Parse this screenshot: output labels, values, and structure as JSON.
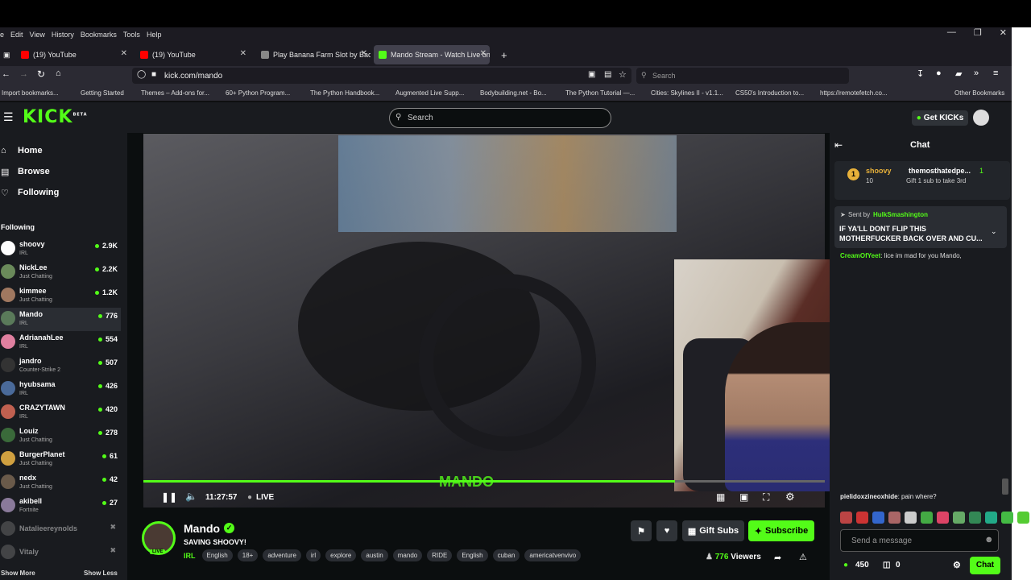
{
  "browser": {
    "menu": [
      "e",
      "Edit",
      "View",
      "History",
      "Bookmarks",
      "Tools",
      "Help"
    ],
    "tabs": [
      {
        "label": "(19) YouTube",
        "active": false
      },
      {
        "label": "(19) YouTube",
        "active": false
      },
      {
        "label": "Play Banana Farm Slot by Backs",
        "active": false
      },
      {
        "label": "Mando Stream - Watch Live on",
        "active": true
      }
    ],
    "url": "kick.com/mando",
    "search_placeholder": "Search",
    "bookmarks": [
      "Import bookmarks...",
      "Getting Started",
      "Themes – Add-ons for...",
      "60+ Python Program...",
      "The Python Handbook...",
      "Augmented Live Supp...",
      "Bodybuilding.net - Bo...",
      "The Python Tutorial —...",
      "Cities: Skylines II - v1.1...",
      "CS50's Introduction to...",
      "https://remotefetch.co...",
      "Other Bookmarks"
    ]
  },
  "header": {
    "logo": "KICK",
    "beta": "BETA",
    "search_placeholder": "Search",
    "get_kicks": "Get KICKs"
  },
  "sidebar": {
    "nav": [
      {
        "label": "Home"
      },
      {
        "label": "Browse"
      },
      {
        "label": "Following"
      }
    ],
    "section": "Following",
    "channels": [
      {
        "name": "shoovy",
        "category": "IRL",
        "viewers": "2.9K"
      },
      {
        "name": "NickLee",
        "category": "Just Chatting",
        "viewers": "2.2K"
      },
      {
        "name": "kimmee",
        "category": "Just Chatting",
        "viewers": "1.2K"
      },
      {
        "name": "Mando",
        "category": "IRL",
        "viewers": "776"
      },
      {
        "name": "AdrianahLee",
        "category": "IRL",
        "viewers": "554"
      },
      {
        "name": "jandro",
        "category": "Counter-Strike 2",
        "viewers": "507"
      },
      {
        "name": "hyubsama",
        "category": "IRL",
        "viewers": "426"
      },
      {
        "name": "CRAZYTAWN",
        "category": "IRL",
        "viewers": "420"
      },
      {
        "name": "Louiz",
        "category": "Just Chatting",
        "viewers": "278"
      },
      {
        "name": "BurgerPlanet",
        "category": "Just Chatting",
        "viewers": "61"
      },
      {
        "name": "nedx",
        "category": "Just Chatting",
        "viewers": "42"
      },
      {
        "name": "akibell",
        "category": "Fortnite",
        "viewers": "27"
      }
    ],
    "offline": [
      "Natalieereynolds",
      "Vitaly"
    ],
    "show_more": "Show More",
    "show_less": "Show Less"
  },
  "player": {
    "time": "11:27:57",
    "live": "LIVE",
    "watermark": "MANDO",
    "progress": 0.78
  },
  "stream": {
    "streamer": "Mando",
    "title": "SAVING SHOOVY!",
    "live_badge": "LIVE",
    "category": "IRL",
    "tags": [
      "English",
      "18+",
      "adventure",
      "irl",
      "explore",
      "austin",
      "mando",
      "RIDE",
      "English",
      "cuban",
      "americatvenvivo"
    ],
    "gift_subs": "Gift Subs",
    "subscribe": "Subscribe",
    "viewers": "776",
    "viewers_label": "Viewers"
  },
  "chat": {
    "title": "Chat",
    "leader": {
      "rank": "1",
      "user1": "shoovy",
      "count1": "10",
      "user2": "themosthatedpe...",
      "count2": "1",
      "hint": "Gift 1 sub to take 3rd"
    },
    "pinned": {
      "sent_by_label": "Sent by",
      "sender": "HulkSmashington",
      "text": "IF YA'LL DONT FLIP THIS MOTHERFUCKER BACK OVER AND CU..."
    },
    "msg1": {
      "user": "CreamOfYeet",
      "text": "lice im mad for you Mando,"
    },
    "msg2": {
      "user": "pielidoxzineoxhide",
      "text": "pain where?"
    },
    "input_placeholder": "Send a message",
    "kicks": "450",
    "points": "0",
    "chat_button": "Chat"
  }
}
